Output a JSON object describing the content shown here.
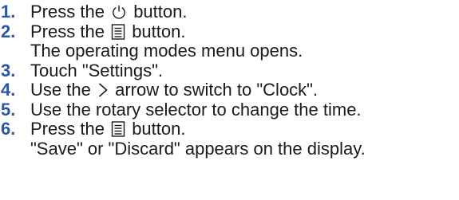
{
  "colors": {
    "number": "#2a56a6",
    "text": "#1a1a1a",
    "background": "#ffffff"
  },
  "steps": [
    {
      "number": "1.",
      "before": "Press the",
      "icon": "power-icon",
      "after": "button."
    },
    {
      "number": "2.",
      "before": "Press the",
      "icon": "menu-icon",
      "after": "button.",
      "result": "The operating modes menu opens."
    },
    {
      "number": "3.",
      "text": "Touch \"Settings\"."
    },
    {
      "number": "4.",
      "before": "Use the",
      "icon": "arrow-right-icon",
      "after": "arrow to switch to \"Clock\"."
    },
    {
      "number": "5.",
      "text": "Use the rotary selector to change the time."
    },
    {
      "number": "6.",
      "before": "Press the",
      "icon": "menu-icon",
      "after": "button.",
      "result": "\"Save\" or \"Discard\" appears on the display."
    }
  ]
}
